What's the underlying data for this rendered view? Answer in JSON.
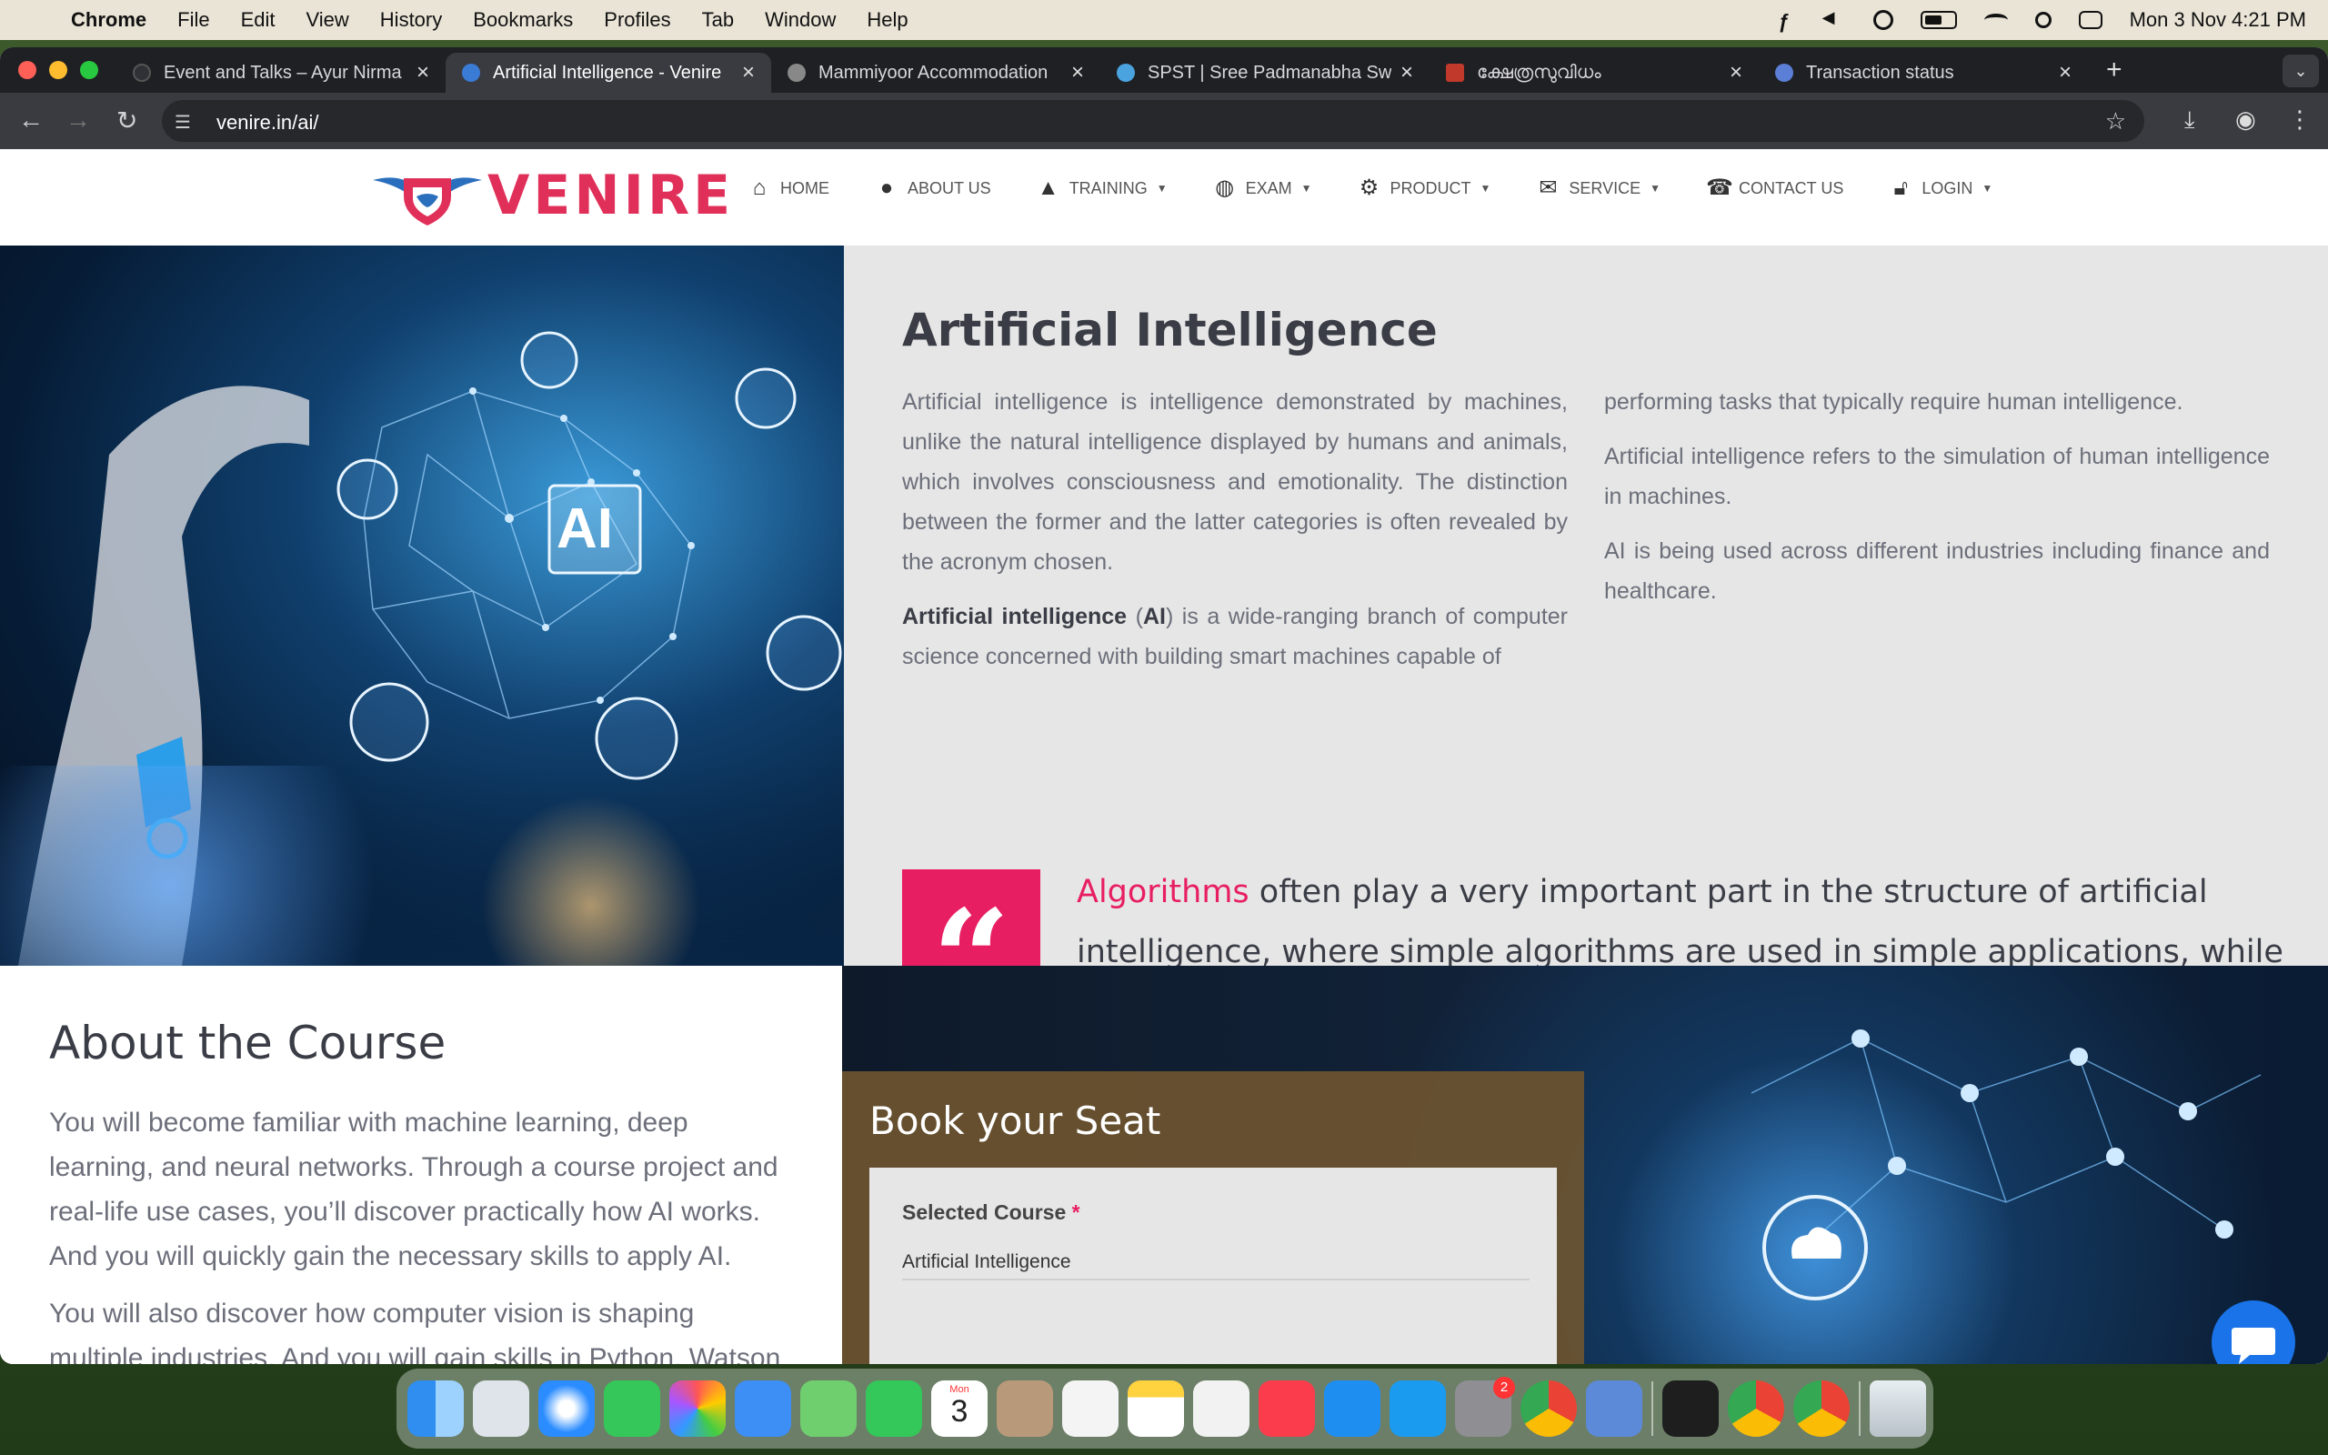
{
  "menubar": {
    "app": "Chrome",
    "items": [
      "File",
      "Edit",
      "View",
      "History",
      "Bookmarks",
      "Profiles",
      "Tab",
      "Window",
      "Help"
    ],
    "clock": "Mon 3 Nov  4:21 PM"
  },
  "browser": {
    "tabs": [
      {
        "title": "Event and Talks – Ayur Nirma",
        "favicon_color": "#2f3136"
      },
      {
        "title": "Artificial Intelligence - Venire",
        "favicon_color": "#3a7bd5"
      },
      {
        "title": "Mammiyoor Accommodation",
        "favicon_color": "#888888"
      },
      {
        "title": "SPST | Sree Padmanabha Sw",
        "favicon_color": "#4aa3df"
      },
      {
        "title": "ക്ഷേത്രസുവിധം",
        "favicon_color": "#c0392b"
      },
      {
        "title": "Transaction status",
        "favicon_color": "#5b7fd6"
      }
    ],
    "url": "venire.in/ai/"
  },
  "site": {
    "brand": "VENIRE",
    "nav": [
      {
        "label": "HOME",
        "icon": "home-icon",
        "dropdown": false
      },
      {
        "label": "ABOUT US",
        "icon": "user-icon",
        "dropdown": false
      },
      {
        "label": "TRAINING",
        "icon": "graduation-cap-icon",
        "dropdown": true
      },
      {
        "label": "EXAM",
        "icon": "globe-icon",
        "dropdown": true
      },
      {
        "label": "PRODUCT",
        "icon": "gear-icon",
        "dropdown": true
      },
      {
        "label": "SERVICE",
        "icon": "chat-icon",
        "dropdown": true
      },
      {
        "label": "CONTACT US",
        "icon": "phone-icon",
        "dropdown": false
      },
      {
        "label": "LOGIN",
        "icon": "lock-icon",
        "dropdown": true
      }
    ]
  },
  "hero": {
    "image_label": "AI",
    "title": "Artificial Intelligence",
    "left_p1": "Artificial intelligence is intelligence demonstrated by machines, unlike the natural intelligence displayed by humans and animals, which involves consciousness and emotionality. The distinction between the former and the latter categories is often revealed by the acronym chosen.",
    "left_p2_bold": "Artificial intelligence",
    "left_p2_paren_open": " (",
    "left_p2_bold2": "AI",
    "left_p2_rest": ") is a wide-ranging branch of computer science concerned with building smart machines capable of",
    "right_p1": "performing tasks that typically require human intelligence.",
    "right_p2": "Artificial intelligence refers to the simulation of human intelligence in machines.",
    "right_p3": "AI is being used across different industries including finance and healthcare.",
    "quote_highlight": "Algorithms",
    "quote_rest": " often play a very important part in the structure of artificial intelligence, where simple algorithms are used in simple applications, while more complex ones help frame strong artificial intelligence."
  },
  "about": {
    "title": "About the Course",
    "p1": "You will become familiar with machine learning, deep learning, and neural networks. Through a course project and real-life use cases, you’ll discover practically how AI works. And you will quickly gain the necessary skills to apply AI.",
    "p2": "You will also discover how computer vision is shaping multiple industries. And you will gain skills in Python, Watson AI and"
  },
  "booking": {
    "title": "Book your Seat",
    "field_label": "Selected Course",
    "required_mark": " *",
    "field_value": "Artificial Intelligence"
  },
  "dock": {
    "calendar_month": "Mon",
    "calendar_day": "3",
    "settings_badge": "2"
  },
  "colors": {
    "accent": "#e81e63",
    "brand": "#e0305a",
    "chat": "#1a73e8"
  }
}
